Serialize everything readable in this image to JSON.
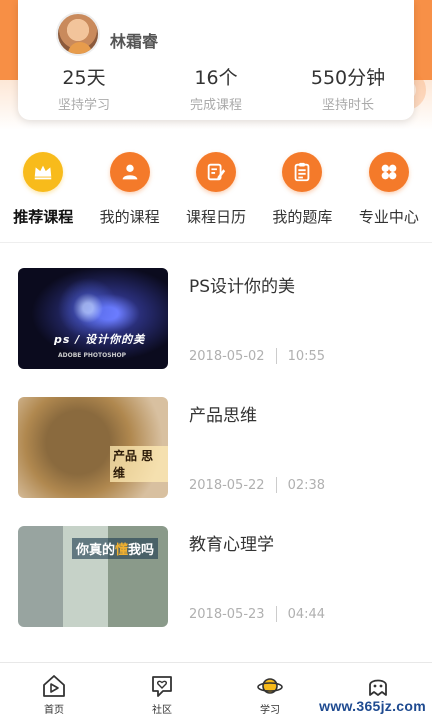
{
  "profile": {
    "name": "林霜睿",
    "stats": [
      {
        "value": "25天",
        "label": "坚持学习"
      },
      {
        "value": "16个",
        "label": "完成课程"
      },
      {
        "value": "550分钟",
        "label": "坚持时长"
      }
    ]
  },
  "categories": [
    {
      "label": "推荐课程",
      "icon": "crown-icon",
      "color": "#f8bb1b",
      "active": true
    },
    {
      "label": "我的课程",
      "icon": "user-icon",
      "color": "#f47a2a"
    },
    {
      "label": "课程日历",
      "icon": "edit-icon",
      "color": "#f47a2a"
    },
    {
      "label": "我的题库",
      "icon": "document-icon",
      "color": "#f47a2a"
    },
    {
      "label": "专业中心",
      "icon": "grid-icon",
      "color": "#f47a2a"
    }
  ],
  "courses": [
    {
      "title": "PS设计你的美",
      "date": "2018-05-02",
      "duration": "10:55",
      "thumb_text": "ps / 设计你的美",
      "thumb_sub": "ADOBE  PHOTOSHOP"
    },
    {
      "title": "产品思维",
      "date": "2018-05-22",
      "duration": "02:38",
      "thumb_text": "产品 思维"
    },
    {
      "title": "教育心理学",
      "date": "2018-05-23",
      "duration": "04:44",
      "thumb_text_a": "你真的",
      "thumb_text_b": "懂",
      "thumb_text_c": "我吗"
    }
  ],
  "tabs": [
    {
      "label": "首页",
      "icon": "home-play-icon"
    },
    {
      "label": "社区",
      "icon": "heart-chat-icon"
    },
    {
      "label": "学习",
      "icon": "planet-icon"
    },
    {
      "label": "",
      "icon": "ghost-icon"
    }
  ],
  "watermark": "www.365jz.com",
  "colors": {
    "accent": "#f7883a",
    "gold": "#f8bb1b",
    "orange": "#f47a2a"
  }
}
